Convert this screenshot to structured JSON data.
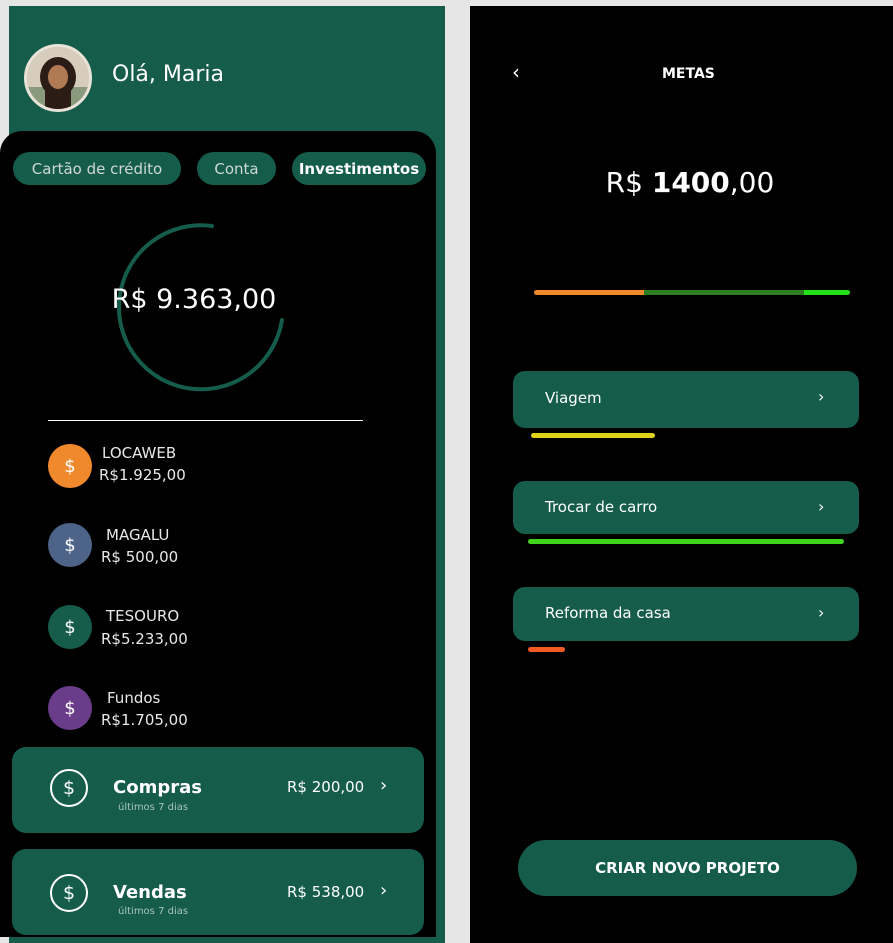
{
  "left": {
    "greeting": "Olá, Maria",
    "tabs": [
      {
        "label": "Cartão de crédito"
      },
      {
        "label": "Conta"
      },
      {
        "label": "Investimentos"
      }
    ],
    "total": "R$ 9.363,00",
    "investments": [
      {
        "name": "LOCAWEB",
        "value": "R$1.925,00",
        "color": "#f0892c",
        "icon": "dollar-icon"
      },
      {
        "name": "MAGALU",
        "value": "R$ 500,00",
        "color": "#4d6387",
        "icon": "dollar-icon"
      },
      {
        "name": "TESOURO",
        "value": "R$5.233,00",
        "color": "#155c4b",
        "icon": "dollar-icon"
      },
      {
        "name": "Fundos",
        "value": "R$1.705,00",
        "color": "#6a3c8a",
        "icon": "dollar-icon"
      }
    ],
    "summary": [
      {
        "title": "Compras",
        "subtitle": "últimos 7 dias",
        "amount": "R$ 200,00"
      },
      {
        "title": "Vendas",
        "subtitle": "últimos 7 dias",
        "amount": "R$ 538,00"
      }
    ],
    "dollar_glyph": "$",
    "chevron_glyph": "›"
  },
  "right": {
    "back_glyph": "‹",
    "title": "METAS",
    "goal_prefix": "R$ ",
    "goal_main": "1400",
    "goal_cents": ",00",
    "goals": [
      {
        "label": "Viagem",
        "color": "#e0d21b"
      },
      {
        "label": "Trocar de carro",
        "color": "#3fd41c"
      },
      {
        "label": "Reforma da casa",
        "color": "#f15a24"
      }
    ],
    "chevron_glyph": "›",
    "create_label": "CRIAR NOVO PROJETO"
  },
  "colors": {
    "brand_green": "#155c4b",
    "background": "#000000",
    "orange": "#f0892c",
    "lime": "#22e01a"
  }
}
